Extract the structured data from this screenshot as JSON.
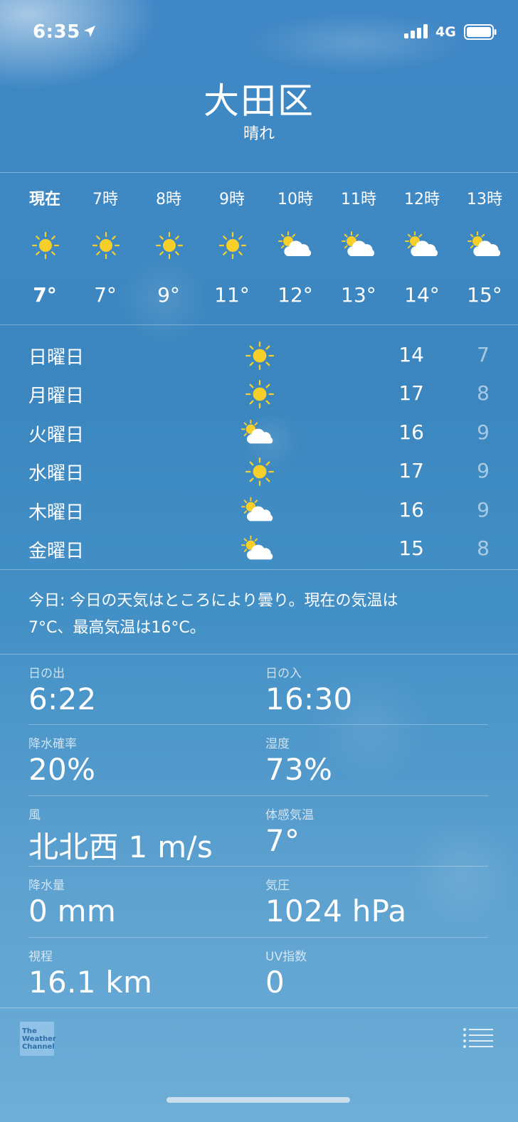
{
  "status_bar": {
    "time": "6:35",
    "network": "4G"
  },
  "header": {
    "city": "大田区",
    "condition": "晴れ"
  },
  "hourly": [
    {
      "label": "現在",
      "icon": "sun-icon",
      "temp": "7°"
    },
    {
      "label": "7時",
      "icon": "sun-icon",
      "temp": "7°"
    },
    {
      "label": "8時",
      "icon": "sun-icon",
      "temp": "9°"
    },
    {
      "label": "9時",
      "icon": "sun-icon",
      "temp": "11°"
    },
    {
      "label": "10時",
      "icon": "partly-cloudy-icon",
      "temp": "12°"
    },
    {
      "label": "11時",
      "icon": "partly-cloudy-icon",
      "temp": "13°"
    },
    {
      "label": "12時",
      "icon": "partly-cloudy-icon",
      "temp": "14°"
    },
    {
      "label": "13時",
      "icon": "partly-cloudy-icon",
      "temp": "15°"
    }
  ],
  "daily": [
    {
      "day": "日曜日",
      "icon": "sun-icon",
      "high": "14",
      "low": "7"
    },
    {
      "day": "月曜日",
      "icon": "sun-icon",
      "high": "17",
      "low": "8"
    },
    {
      "day": "火曜日",
      "icon": "partly-cloudy-icon",
      "high": "16",
      "low": "9"
    },
    {
      "day": "水曜日",
      "icon": "sun-icon",
      "high": "17",
      "low": "9"
    },
    {
      "day": "木曜日",
      "icon": "partly-cloudy-icon",
      "high": "16",
      "low": "9"
    },
    {
      "day": "金曜日",
      "icon": "partly-cloudy-icon",
      "high": "15",
      "low": "8"
    }
  ],
  "summary": {
    "line1": "今日: 今日の天気はところにより曇り。現在の気温は",
    "line2": "7°C、最高気温は16°C。"
  },
  "details": [
    {
      "label": "日の出",
      "value": "6:22"
    },
    {
      "label": "日の入",
      "value": "16:30"
    },
    {
      "label": "降水確率",
      "value": "20%"
    },
    {
      "label": "湿度",
      "value": "73%"
    },
    {
      "label": "風",
      "value": "北北西 1 m/s"
    },
    {
      "label": "体感気温",
      "value": "7°"
    },
    {
      "label": "降水量",
      "value": "0 mm"
    },
    {
      "label": "気圧",
      "value": "1024 hPa"
    },
    {
      "label": "視程",
      "value": "16.1 km"
    },
    {
      "label": "UV指数",
      "value": "0"
    }
  ],
  "footer": {
    "logo_line1": "The",
    "logo_line2": "Weather",
    "logo_line3": "Channel"
  },
  "colors": {
    "sun": "#f7cf2a",
    "cloud": "#ffffff",
    "sky_top": "#3f87c6",
    "sky_bottom": "#6eaed8"
  }
}
